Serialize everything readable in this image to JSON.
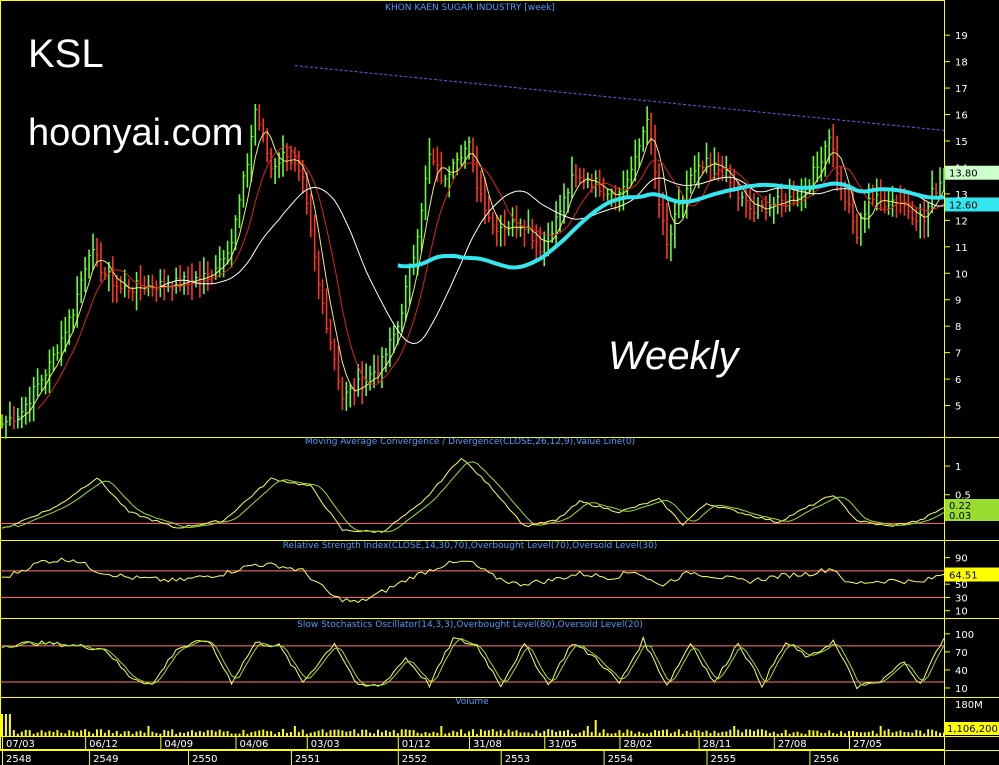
{
  "overlay": {
    "ticker": "KSL",
    "site": "hoonyai.com",
    "period": "Weekly"
  },
  "colors": {
    "background": "#000000",
    "frame": "#ffff00",
    "title": "#4a9cff",
    "axis_text": "#ffffff",
    "bar_up": "#66ff33",
    "bar_down": "#ff3322",
    "ma_fast": "#e8f070",
    "ma_mid": "#dd2222",
    "ma_slow": "#ffffff",
    "ma_long": "#33e6f0",
    "trendline": "#8844ff",
    "level_line": "#ff7777",
    "indicator": "#ffff55",
    "indicator2": "#99dd33",
    "volume": "#ffff00",
    "last_price_box": "#ccffcc",
    "ma_box": "#33e6f0",
    "rsi_box": "#ffff00"
  },
  "chart_data": [
    {
      "type": "bar",
      "panel": "price",
      "title": "KHON KAEN SUGAR INDUSTRY [week]",
      "ylim": [
        4,
        19.8
      ],
      "y_ticks": [
        "19",
        "18",
        "17",
        "16",
        "15",
        "14",
        "13",
        "12",
        "11",
        "10",
        "9",
        "8",
        "7",
        "6",
        "5"
      ],
      "last_price_label": "13.80",
      "ma_value_label": "12.60",
      "x_date_labels": [
        "07/03",
        "06/12",
        "04/09",
        "04/06",
        "03/03",
        "01/12",
        "31/08",
        "31/05",
        "28/02",
        "28/11",
        "27/08",
        "27/05"
      ],
      "x_year_labels": [
        "2548",
        "2549",
        "2550",
        "2551",
        "2552",
        "2553",
        "2554",
        "2555",
        "2556"
      ],
      "close_keypoints": [
        [
          0,
          4.3
        ],
        [
          5,
          4.8
        ],
        [
          12,
          6.5
        ],
        [
          18,
          8.6
        ],
        [
          22,
          10.9
        ],
        [
          26,
          10.0
        ],
        [
          30,
          9.4
        ],
        [
          36,
          9.5
        ],
        [
          44,
          9.6
        ],
        [
          52,
          9.9
        ],
        [
          58,
          11.2
        ],
        [
          62,
          14.2
        ],
        [
          64,
          16.2
        ],
        [
          68,
          14.0
        ],
        [
          72,
          14.6
        ],
        [
          76,
          13.4
        ],
        [
          80,
          9.5
        ],
        [
          84,
          6.8
        ],
        [
          86,
          5.3
        ],
        [
          92,
          6.0
        ],
        [
          96,
          6.6
        ],
        [
          100,
          8.0
        ],
        [
          104,
          10.7
        ],
        [
          108,
          14.4
        ],
        [
          112,
          13.4
        ],
        [
          114,
          14.4
        ],
        [
          118,
          14.8
        ],
        [
          120,
          13.4
        ],
        [
          124,
          11.8
        ],
        [
          128,
          11.8
        ],
        [
          132,
          11.9
        ],
        [
          136,
          11.0
        ],
        [
          140,
          12.0
        ],
        [
          144,
          13.5
        ],
        [
          148,
          13.6
        ],
        [
          152,
          13.2
        ],
        [
          156,
          13.0
        ],
        [
          160,
          14.2
        ],
        [
          163,
          16.0
        ],
        [
          166,
          12.6
        ],
        [
          168,
          11.0
        ],
        [
          170,
          12.0
        ],
        [
          174,
          13.6
        ],
        [
          178,
          14.1
        ],
        [
          182,
          13.9
        ],
        [
          186,
          12.9
        ],
        [
          190,
          12.3
        ],
        [
          194,
          12.6
        ],
        [
          198,
          12.7
        ],
        [
          202,
          13.1
        ],
        [
          206,
          14.0
        ],
        [
          209,
          15.3
        ],
        [
          212,
          13.2
        ],
        [
          214,
          12.4
        ],
        [
          216,
          11.4
        ],
        [
          219,
          12.9
        ],
        [
          222,
          12.7
        ],
        [
          226,
          12.8
        ],
        [
          230,
          12.3
        ],
        [
          233,
          12.0
        ],
        [
          235,
          13.0
        ],
        [
          238,
          13.7
        ]
      ],
      "trendline": {
        "from": [
          74,
          17.85
        ],
        "to": [
          238,
          15.4
        ]
      },
      "moving_averages": [
        "fast",
        "mid",
        "slow",
        "long"
      ]
    },
    {
      "type": "line",
      "panel": "macd",
      "title": "Moving Average Convergence / Divergence(CLOSE,26,12,9),Value Line(0)",
      "ylim": [
        -0.22,
        1.35
      ],
      "y_ticks": [
        "1",
        "0.5"
      ],
      "last_value_labels": [
        "0.22",
        "0.03"
      ],
      "keypoints": [
        [
          0,
          -0.1
        ],
        [
          14,
          0.3
        ],
        [
          24,
          0.8
        ],
        [
          32,
          0.2
        ],
        [
          44,
          -0.08
        ],
        [
          56,
          0.05
        ],
        [
          68,
          0.78
        ],
        [
          78,
          0.65
        ],
        [
          86,
          -0.12
        ],
        [
          96,
          -0.15
        ],
        [
          106,
          0.35
        ],
        [
          116,
          1.15
        ],
        [
          124,
          0.6
        ],
        [
          132,
          -0.05
        ],
        [
          140,
          0.05
        ],
        [
          146,
          0.38
        ],
        [
          156,
          0.2
        ],
        [
          166,
          0.42
        ],
        [
          172,
          -0.02
        ],
        [
          178,
          0.35
        ],
        [
          186,
          0.2
        ],
        [
          196,
          0.02
        ],
        [
          204,
          0.3
        ],
        [
          210,
          0.5
        ],
        [
          216,
          0.05
        ],
        [
          224,
          -0.05
        ],
        [
          232,
          0.05
        ],
        [
          238,
          0.28
        ]
      ],
      "zero_level": 0
    },
    {
      "type": "line",
      "panel": "rsi",
      "title": "Relative Strength Index(CLOSE,14,30,70),Overbought Level(70),Oversold Level(30)",
      "ylim": [
        5,
        100
      ],
      "y_ticks": [
        "90",
        "70",
        "50",
        "30",
        "10"
      ],
      "last_value_label": "64.51",
      "levels": [
        70,
        30
      ],
      "keypoints": [
        [
          0,
          58
        ],
        [
          10,
          84
        ],
        [
          18,
          88
        ],
        [
          24,
          70
        ],
        [
          32,
          60
        ],
        [
          44,
          55
        ],
        [
          56,
          66
        ],
        [
          64,
          80
        ],
        [
          70,
          78
        ],
        [
          76,
          70
        ],
        [
          84,
          30
        ],
        [
          90,
          22
        ],
        [
          96,
          38
        ],
        [
          104,
          62
        ],
        [
          112,
          80
        ],
        [
          118,
          84
        ],
        [
          124,
          62
        ],
        [
          130,
          50
        ],
        [
          138,
          55
        ],
        [
          146,
          66
        ],
        [
          154,
          60
        ],
        [
          160,
          70
        ],
        [
          166,
          48
        ],
        [
          174,
          68
        ],
        [
          180,
          62
        ],
        [
          188,
          54
        ],
        [
          196,
          62
        ],
        [
          204,
          66
        ],
        [
          210,
          74
        ],
        [
          214,
          50
        ],
        [
          220,
          54
        ],
        [
          226,
          56
        ],
        [
          232,
          52
        ],
        [
          238,
          66
        ]
      ]
    },
    {
      "type": "line",
      "panel": "stochastic",
      "title": "Slow Stochastics Oscillator(14,3,3),Overbought Level(80),Oversold Level(20)",
      "ylim": [
        0,
        108
      ],
      "y_ticks": [
        "100",
        "70",
        "40",
        "10"
      ],
      "levels": [
        80,
        20
      ],
      "keypoints": [
        [
          0,
          80
        ],
        [
          8,
          85
        ],
        [
          16,
          82
        ],
        [
          26,
          75
        ],
        [
          32,
          30
        ],
        [
          38,
          15
        ],
        [
          44,
          75
        ],
        [
          52,
          90
        ],
        [
          58,
          20
        ],
        [
          64,
          85
        ],
        [
          70,
          80
        ],
        [
          76,
          20
        ],
        [
          84,
          85
        ],
        [
          90,
          12
        ],
        [
          96,
          15
        ],
        [
          102,
          60
        ],
        [
          108,
          15
        ],
        [
          114,
          92
        ],
        [
          120,
          80
        ],
        [
          126,
          15
        ],
        [
          132,
          82
        ],
        [
          138,
          15
        ],
        [
          144,
          85
        ],
        [
          150,
          60
        ],
        [
          156,
          18
        ],
        [
          162,
          90
        ],
        [
          168,
          15
        ],
        [
          174,
          85
        ],
        [
          180,
          18
        ],
        [
          186,
          86
        ],
        [
          192,
          15
        ],
        [
          198,
          85
        ],
        [
          204,
          60
        ],
        [
          210,
          88
        ],
        [
          216,
          12
        ],
        [
          222,
          20
        ],
        [
          228,
          55
        ],
        [
          232,
          15
        ],
        [
          238,
          95
        ]
      ]
    },
    {
      "type": "bar",
      "panel": "volume",
      "title": "Volume",
      "y_ticks": [
        "180M"
      ],
      "last_value_label": "1,106,200"
    }
  ]
}
